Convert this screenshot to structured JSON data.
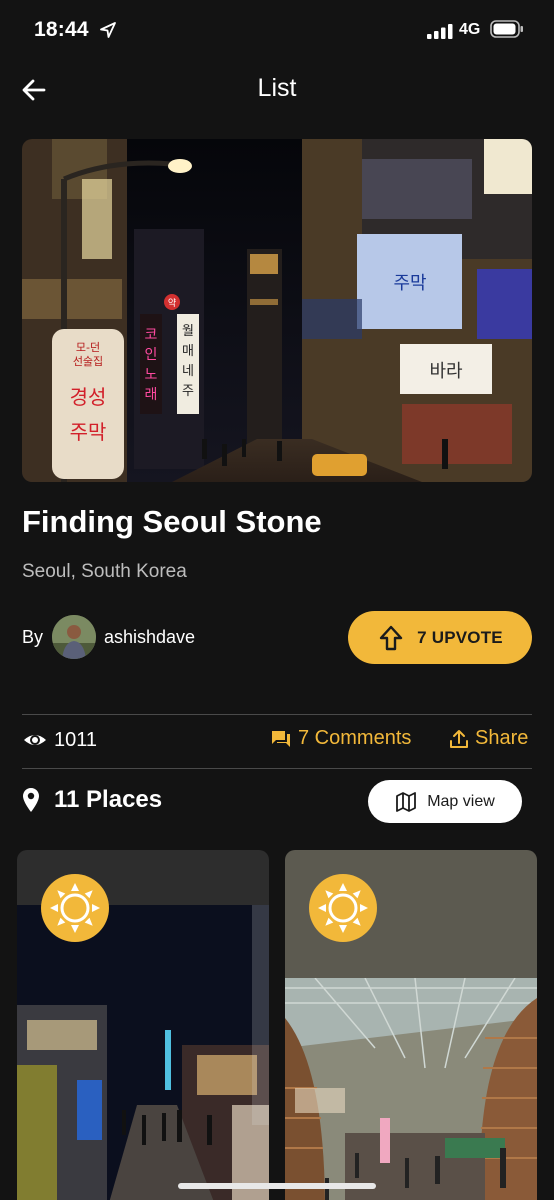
{
  "status_bar": {
    "time": "18:44",
    "network": "4G"
  },
  "nav": {
    "title": "List"
  },
  "list": {
    "title": "Finding Seoul Stone",
    "location": "Seoul, South Korea",
    "by_label": "By",
    "author": "ashishdave",
    "upvote_label": "7 UPVOTE",
    "views": "1011",
    "comments_label": "7 Comments",
    "share_label": "Share",
    "places_label": "11 Places",
    "map_view_label": "Map view"
  },
  "hero_signs": [
    "모-던 선술집",
    "경성주막",
    "코인노래",
    "월매네주막",
    "약",
    "바라"
  ],
  "colors": {
    "accent": "#f2b83a",
    "background": "#131313",
    "divider": "#4a4a4a"
  },
  "icons": [
    "location-arrow-icon",
    "signal-icon",
    "battery-icon",
    "back-arrow-icon",
    "arrow-up-icon",
    "eye-icon",
    "comments-icon",
    "share-icon",
    "map-pin-icon",
    "map-icon",
    "sun-icon"
  ]
}
